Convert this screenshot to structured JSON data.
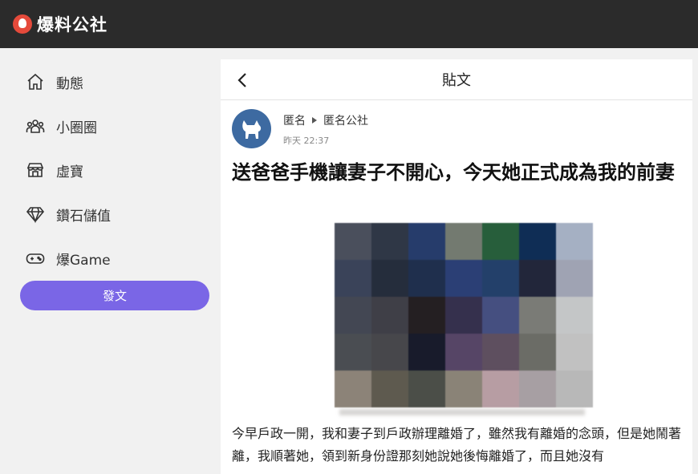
{
  "app": {
    "brand": "爆料公社"
  },
  "sidebar": {
    "items": [
      {
        "label": "動態",
        "icon": "home-icon"
      },
      {
        "label": "小圈圈",
        "icon": "group-icon"
      },
      {
        "label": "虛寶",
        "icon": "store-icon"
      },
      {
        "label": "鑽石儲值",
        "icon": "diamond-icon"
      },
      {
        "label": "爆Game",
        "icon": "gamepad-icon"
      }
    ],
    "post_button": "發文"
  },
  "post": {
    "header_title": "貼文",
    "author": "匿名",
    "board": "匿名公社",
    "time": "昨天 22:37",
    "title": "送爸爸手機讓妻子不開心，今天她正式成為我的前妻",
    "body": "今早戶政一開，我和妻子到戶政辦理離婚了，雖然我有離婚的念頭，但是她鬧著離，我順著她，領到新身份證那刻她說她後悔離婚了，而且她沒有",
    "image_colors": [
      [
        "#4a4f5c",
        "#2f3746",
        "#263c6b",
        "#737a70",
        "#275e3b",
        "#0f2d55",
        "#a5b0c3"
      ],
      [
        "#3a4359",
        "#252d3c",
        "#1f2f4d",
        "#2b3f75",
        "#23406a",
        "#22263a",
        "#9fa3b3"
      ],
      [
        "#434753",
        "#3f3f47",
        "#241f22",
        "#35304d",
        "#454f80",
        "#7a7b76",
        "#c4c6c7"
      ],
      [
        "#4a4d52",
        "#47474b",
        "#181b2b",
        "#564566",
        "#5e4f5f",
        "#6b6c66",
        "#c1c1c1"
      ],
      [
        "#8c8378",
        "#5e5a4f",
        "#4b4e48",
        "#8a8377",
        "#b79da3",
        "#a79fa3",
        "#b8b8b8"
      ]
    ]
  }
}
